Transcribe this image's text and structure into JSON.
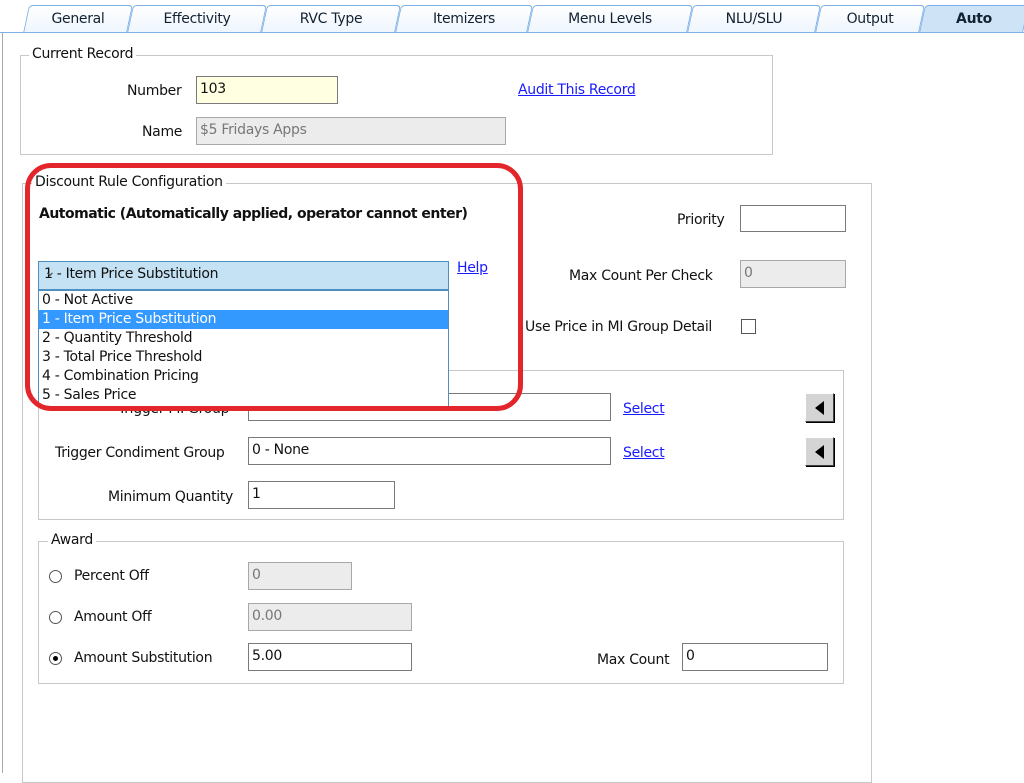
{
  "tabs": [
    {
      "label": "General",
      "active": false
    },
    {
      "label": "Effectivity",
      "active": false
    },
    {
      "label": "RVC Type",
      "active": false
    },
    {
      "label": "Itemizers",
      "active": false
    },
    {
      "label": "Menu Levels",
      "active": false
    },
    {
      "label": "NLU/SLU",
      "active": false
    },
    {
      "label": "Output",
      "active": false
    },
    {
      "label": "Auto",
      "active": true
    }
  ],
  "current_record": {
    "title": "Current Record",
    "number_label": "Number",
    "number_value": "103",
    "name_label": "Name",
    "name_value": "$5 Fridays Apps",
    "audit_link": "Audit This Record"
  },
  "discount": {
    "title": "Discount Rule Configuration",
    "mode_heading": "Automatic (Automatically applied, operator cannot enter)",
    "rule_type_selected": "1 - Item Price Substitution",
    "rule_type_options": [
      "0 - Not Active",
      "1 - Item Price Substitution",
      "2 - Quantity Threshold",
      "3 - Total Price Threshold",
      "4 - Combination Pricing",
      "5 - Sales Price"
    ],
    "help_link": "Help",
    "priority_label": "Priority",
    "priority_value": "",
    "max_count_per_check_label": "Max Count Per Check",
    "max_count_per_check_value": "0",
    "use_price_label": "Use Price in MI Group Detail",
    "use_price_checked": false
  },
  "trigger": {
    "mi_group_label": "Trigger MI Group",
    "condiment_group_label": "Trigger Condiment Group",
    "condiment_group_value": "0 - None",
    "select_link": "Select",
    "min_qty_label": "Minimum Quantity",
    "min_qty_value": "1"
  },
  "award": {
    "title": "Award",
    "percent_off_label": "Percent Off",
    "percent_off_value": "0",
    "amount_off_label": "Amount Off",
    "amount_off_value": "0.00",
    "amount_sub_label": "Amount Substitution",
    "amount_sub_value": "5.00",
    "selected": "Amount Substitution",
    "max_count_label": "Max Count",
    "max_count_value": "0"
  },
  "colors": {
    "highlight": "#e3262b",
    "selection": "#3399ff",
    "link": "#1a1aff"
  }
}
